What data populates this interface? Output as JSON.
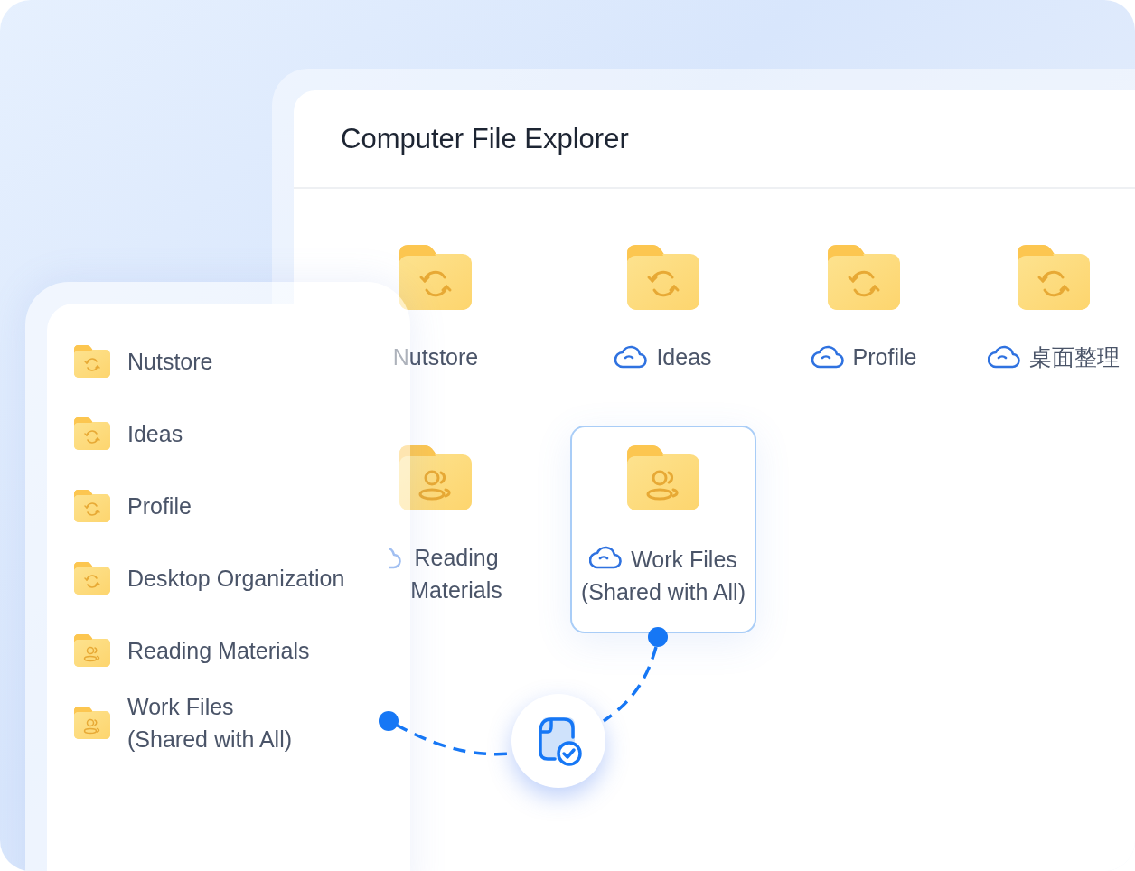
{
  "window": {
    "title": "Computer File Explorer"
  },
  "folders": [
    {
      "name": "Nutstore",
      "kind": "sync",
      "cloud": false,
      "selected": false
    },
    {
      "name": "Ideas",
      "kind": "sync",
      "cloud": true,
      "selected": false
    },
    {
      "name": "Profile",
      "kind": "sync",
      "cloud": true,
      "selected": false
    },
    {
      "name": "桌面整理",
      "kind": "sync",
      "cloud": true,
      "selected": false
    },
    {
      "name": "Reading\nMaterials",
      "kind": "shared",
      "cloud": true,
      "selected": false
    },
    {
      "name": "Work Files\n(Shared with All)",
      "kind": "shared",
      "cloud": true,
      "selected": true
    }
  ],
  "sidebar": {
    "items": [
      {
        "name": "Nutstore",
        "kind": "sync"
      },
      {
        "name": "Ideas",
        "kind": "sync"
      },
      {
        "name": "Profile",
        "kind": "sync"
      },
      {
        "name": "Desktop Organization",
        "kind": "sync"
      },
      {
        "name": "Reading Materials",
        "kind": "shared"
      },
      {
        "name": "Work Files\n(Shared with All)",
        "kind": "shared"
      }
    ]
  }
}
